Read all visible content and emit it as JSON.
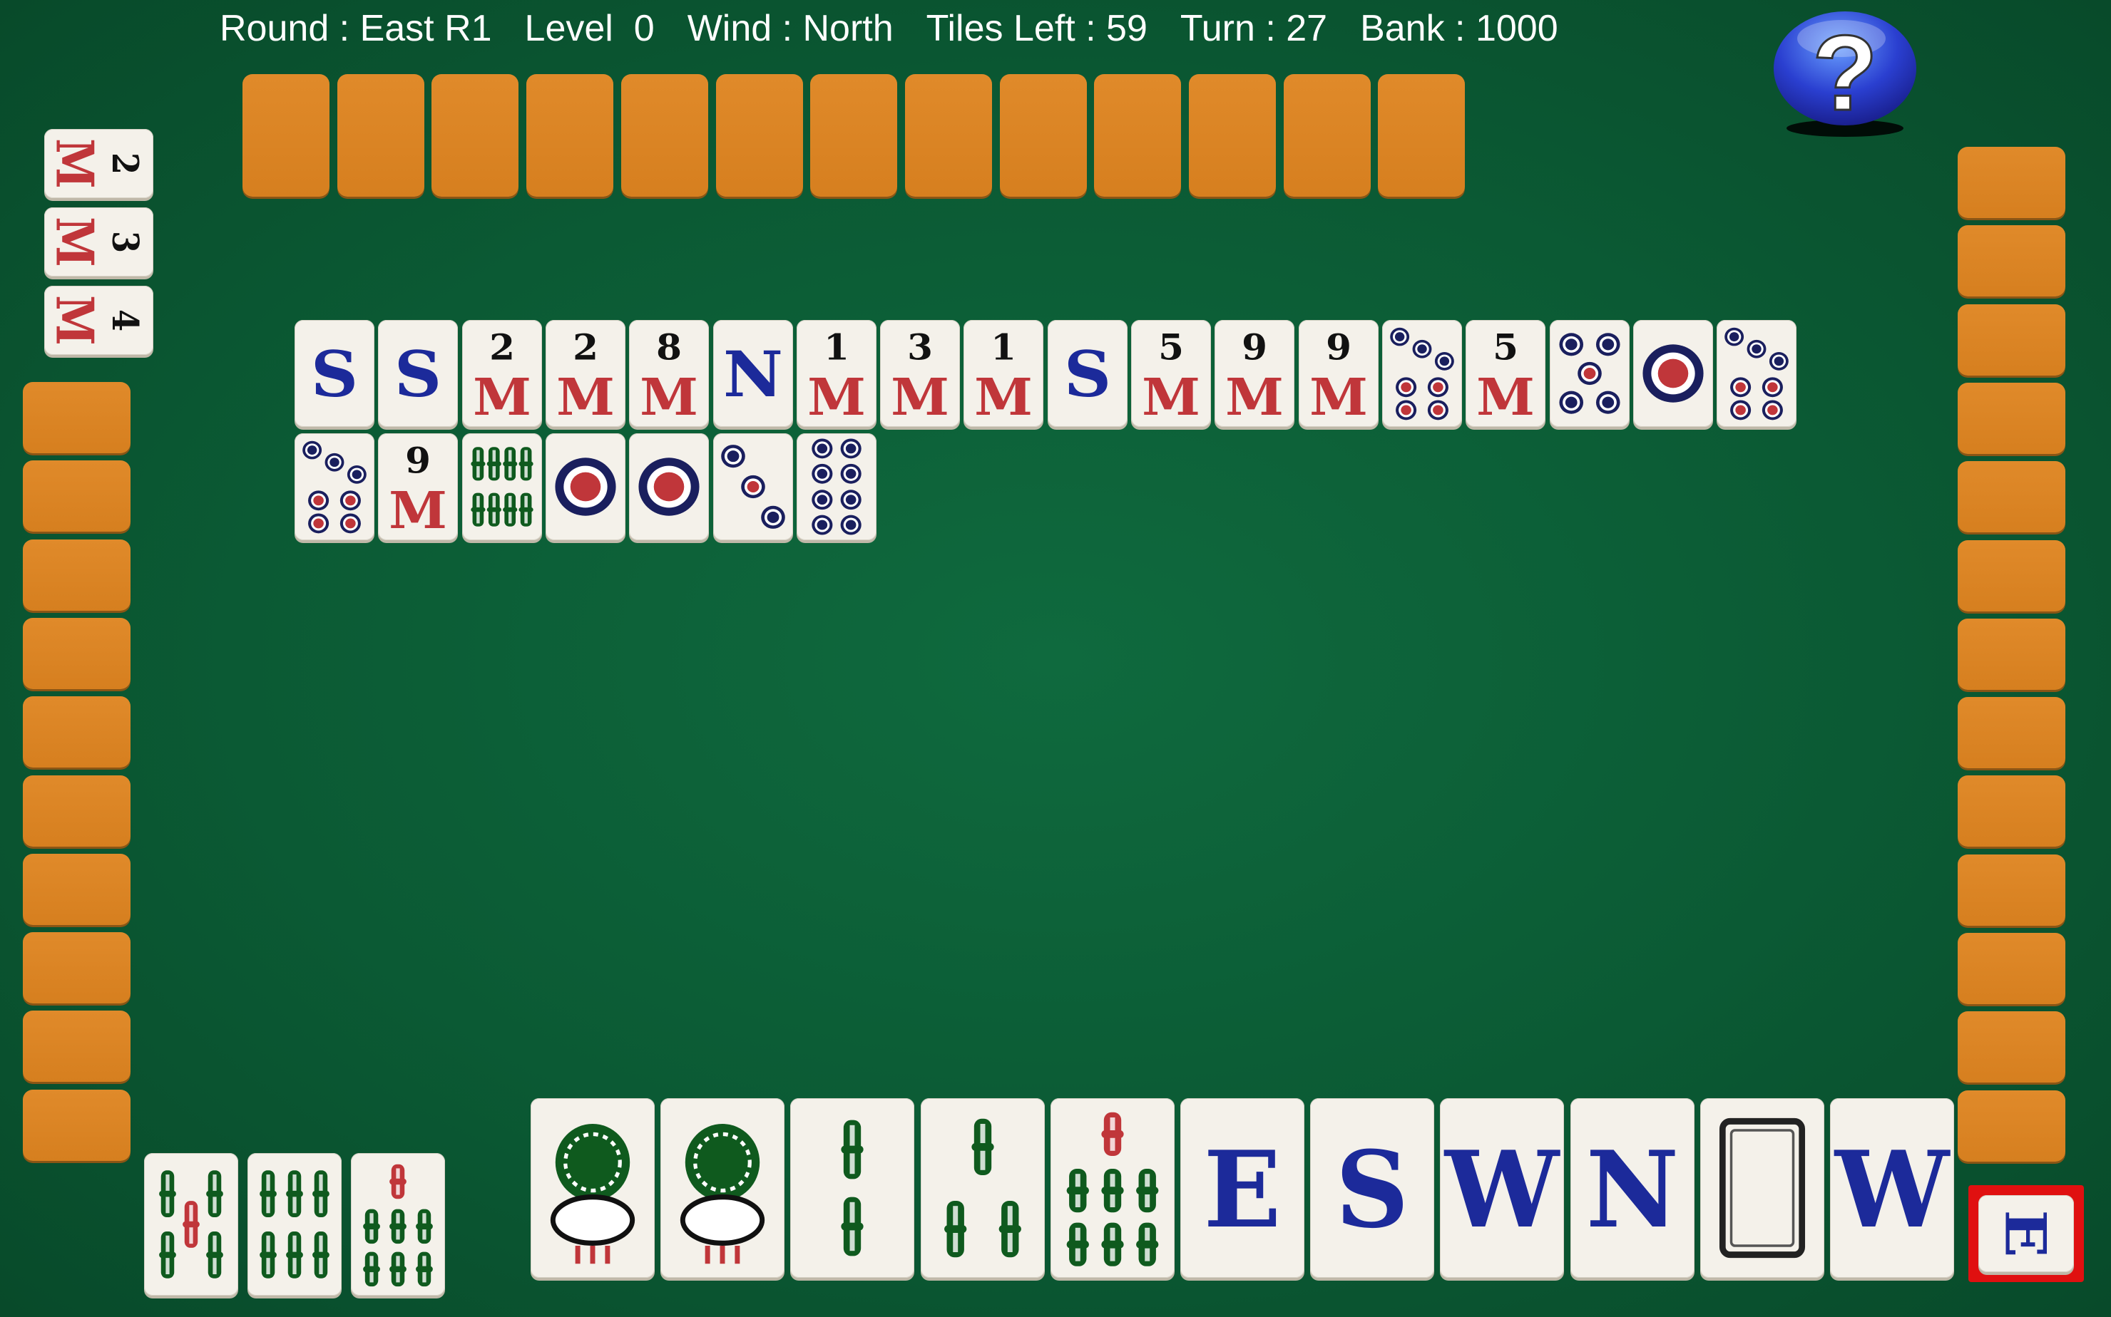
{
  "status": {
    "round": "Round : East R1",
    "level": "Level  0",
    "wind": "Wind : North",
    "tiles_left": "Tiles Left : 59",
    "turn": "Turn : 27",
    "bank": "Bank : 1000"
  },
  "help_button": {
    "icon": "question-mark-icon",
    "glyph": "?"
  },
  "colors": {
    "table": "#0b5a34",
    "tile_back": "#d98424",
    "tile_face": "#f4f1ea",
    "wind_blue": "#1c2a9a",
    "char_red": "#c0363a",
    "bamboo_green": "#0f5a1e",
    "dot_navy": "#1a1f5e",
    "round_wind_frame": "#e01010"
  },
  "opponents": {
    "top_concealed": 13,
    "left_concealed": 10,
    "right_concealed": 13
  },
  "left_meld": [
    "2m",
    "3m",
    "4m"
  ],
  "discards": {
    "row1": [
      "S",
      "S",
      "2m",
      "2m",
      "8m",
      "N",
      "1m",
      "3m",
      "1m",
      "S",
      "5m",
      "9m",
      "9m",
      "7p",
      "5m",
      "5p",
      "1p",
      "7p"
    ],
    "row2": [
      "7p",
      "9m",
      "8s",
      "1p",
      "1p",
      "3p",
      "8p"
    ]
  },
  "player_meld": [
    "5s",
    "6s",
    "7s"
  ],
  "hand": [
    "1s",
    "1s",
    "2s",
    "3s",
    "7s",
    "E",
    "S",
    "W",
    "N",
    "Wh",
    "W"
  ],
  "round_wind_indicator": "E"
}
